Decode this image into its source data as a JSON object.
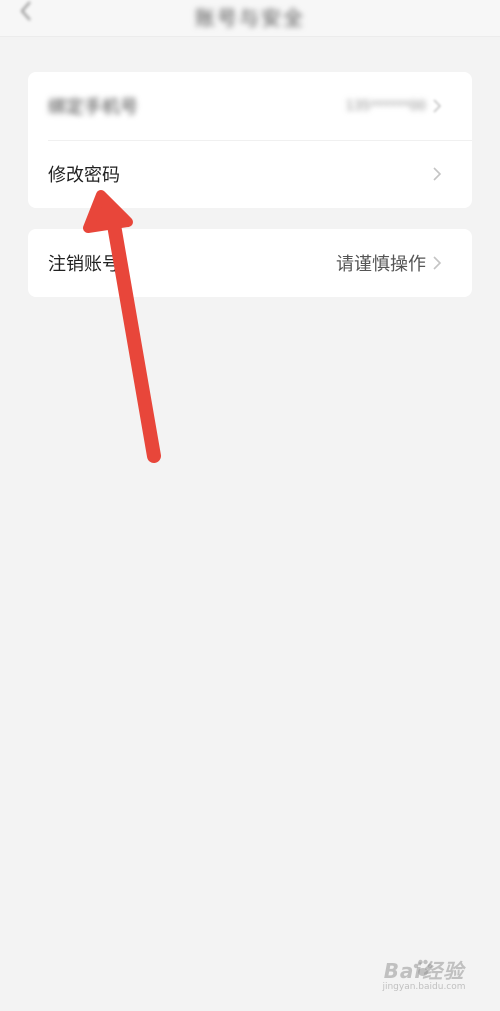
{
  "header": {
    "title": "账号与安全",
    "back_icon": "chevron-left-icon"
  },
  "settings": {
    "group1": {
      "row1": {
        "label": "绑定手机号",
        "value": "135******00"
      },
      "row2": {
        "label": "修改密码"
      }
    },
    "group2": {
      "row1": {
        "label": "注销账号",
        "value": "请谨慎操作"
      }
    }
  },
  "chevron_icon": "chevron-right-icon",
  "annotation": {
    "arrow_color": "#e8463a"
  },
  "watermark": {
    "brand": "Bai经验",
    "sub": "jingyan.baidu.com"
  }
}
